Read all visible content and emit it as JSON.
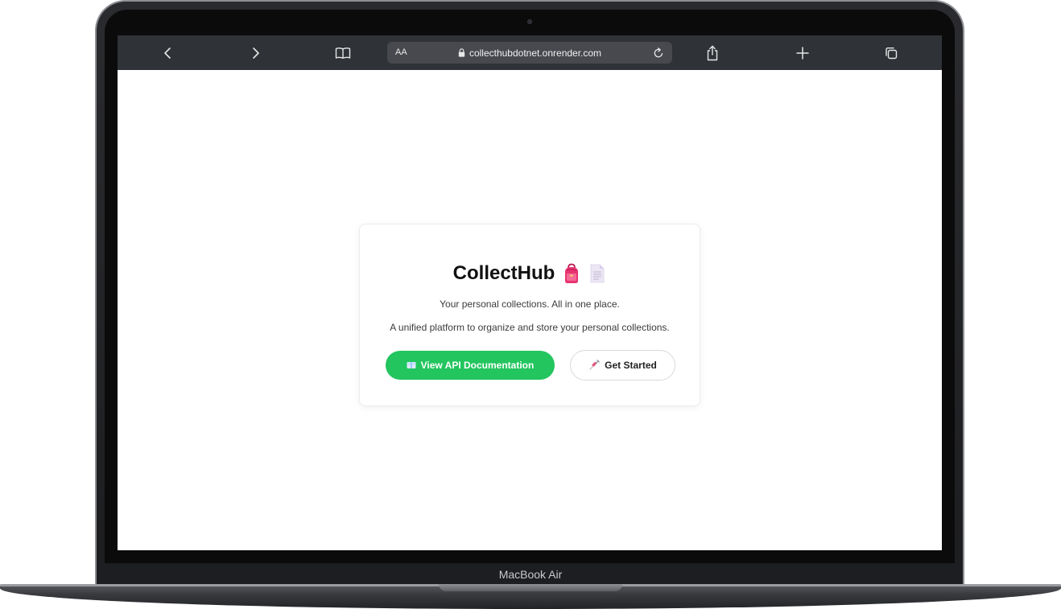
{
  "browser": {
    "aa_label": "AA",
    "url": "collecthubdotnet.onrender.com",
    "buttons": {
      "back_icon": "chevron-left-icon",
      "forward_icon": "chevron-right-icon",
      "bookmarks_icon": "book-icon",
      "reload_icon": "reload-icon",
      "share_icon": "share-icon",
      "new_tab_icon": "plus-icon",
      "tabs_icon": "tabs-icon"
    }
  },
  "card": {
    "title": "CollectHub",
    "title_emojis": [
      "backpack-icon",
      "page-icon"
    ],
    "tagline": "Your personal collections. All in one place.",
    "description": "A unified platform to organize and store your personal collections.",
    "primary_button": {
      "icon": "book-icon",
      "label": "View API Documentation",
      "color": "#22c55e"
    },
    "secondary_button": {
      "icon": "syringe-icon",
      "label": "Get Started"
    }
  },
  "device": {
    "model": "MacBook Air"
  }
}
